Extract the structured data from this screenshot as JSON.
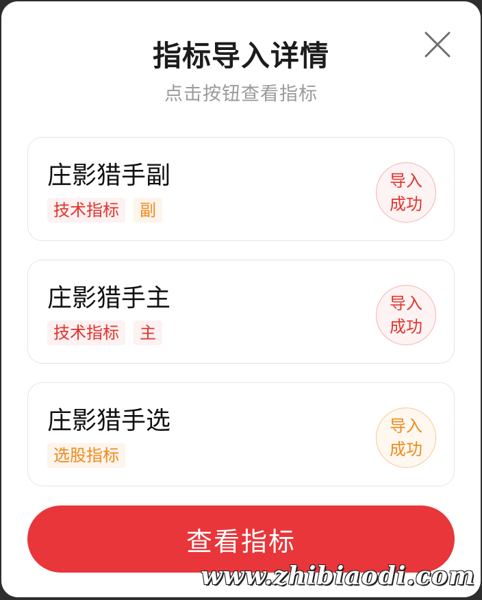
{
  "dialog": {
    "title": "指标导入详情",
    "subtitle": "点击按钮查看指标",
    "close_icon": "close-icon"
  },
  "items": [
    {
      "name": "庄影猎手副",
      "tags": [
        {
          "label": "技术指标",
          "color": "#e2332d"
        },
        {
          "label": "副",
          "color": "#f08a1c"
        }
      ],
      "status_line1": "导入",
      "status_line2": "成功",
      "status_color": "#e2332d"
    },
    {
      "name": "庄影猎手主",
      "tags": [
        {
          "label": "技术指标",
          "color": "#e2332d"
        },
        {
          "label": "主",
          "color": "#e2332d"
        }
      ],
      "status_line1": "导入",
      "status_line2": "成功",
      "status_color": "#e2332d"
    },
    {
      "name": "庄影猎手选",
      "tags": [
        {
          "label": "选股指标",
          "color": "#f08a1c"
        }
      ],
      "status_line1": "导入",
      "status_line2": "成功",
      "status_color": "#f08a1c"
    }
  ],
  "button": {
    "label": "查看指标",
    "color": "#e8363a"
  },
  "watermark": {
    "text": "www.zhibiaodi.com"
  }
}
